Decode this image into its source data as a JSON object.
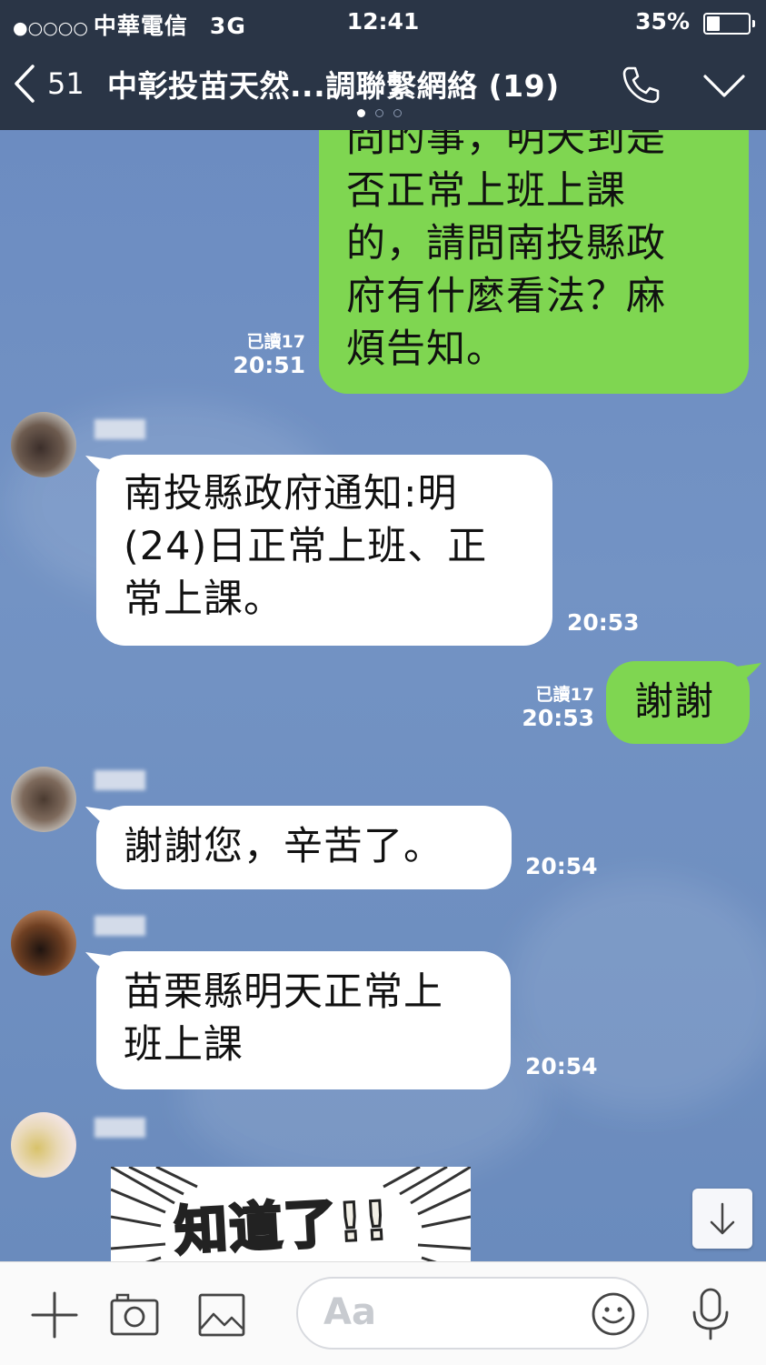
{
  "status_bar": {
    "carrier_dots": "●○○○○",
    "carrier": "中華電信",
    "network": "3G",
    "time": "12:41",
    "battery": "35%",
    "battery_level": 0.35
  },
  "header": {
    "back_count": "51",
    "title": "中彰投苗天然...調聯繫網絡 (19)",
    "page_dots": 3,
    "active_page": 0
  },
  "messages": [
    {
      "side": "me",
      "text": "問的事，明天到是否正常上班上課的，請問南投縣政府有什麼看法？麻煩告知。",
      "lines": [
        "問的事，明天到是",
        "否正常上班上課",
        "的，請問南投縣政",
        "府有什麼看法？麻",
        "煩告知。"
      ],
      "read": "已讀17",
      "time": "20:51"
    },
    {
      "side": "other",
      "lines": [
        "南投縣政府通知:明",
        "(24)日正常上班、正",
        "常上課。"
      ],
      "time": "20:53"
    },
    {
      "side": "me",
      "lines": [
        "謝謝"
      ],
      "read": "已讀17",
      "time": "20:53"
    },
    {
      "side": "other",
      "lines": [
        "謝謝您，辛苦了。"
      ],
      "time": "20:54"
    },
    {
      "side": "other",
      "lines": [
        "苗栗縣明天正常上",
        "班上課"
      ],
      "time": "20:54"
    }
  ],
  "sticker": {
    "text": "知道了!!"
  },
  "input_bar": {
    "placeholder": "Aa",
    "icons": [
      "plus-icon",
      "camera-icon",
      "image-icon",
      "emoji-icon",
      "microphone-icon"
    ]
  },
  "colors": {
    "header_bg": "#2a3546",
    "chat_bg": "#6f8fc0",
    "my_bubble": "#7fd651",
    "other_bubble": "#ffffff"
  }
}
